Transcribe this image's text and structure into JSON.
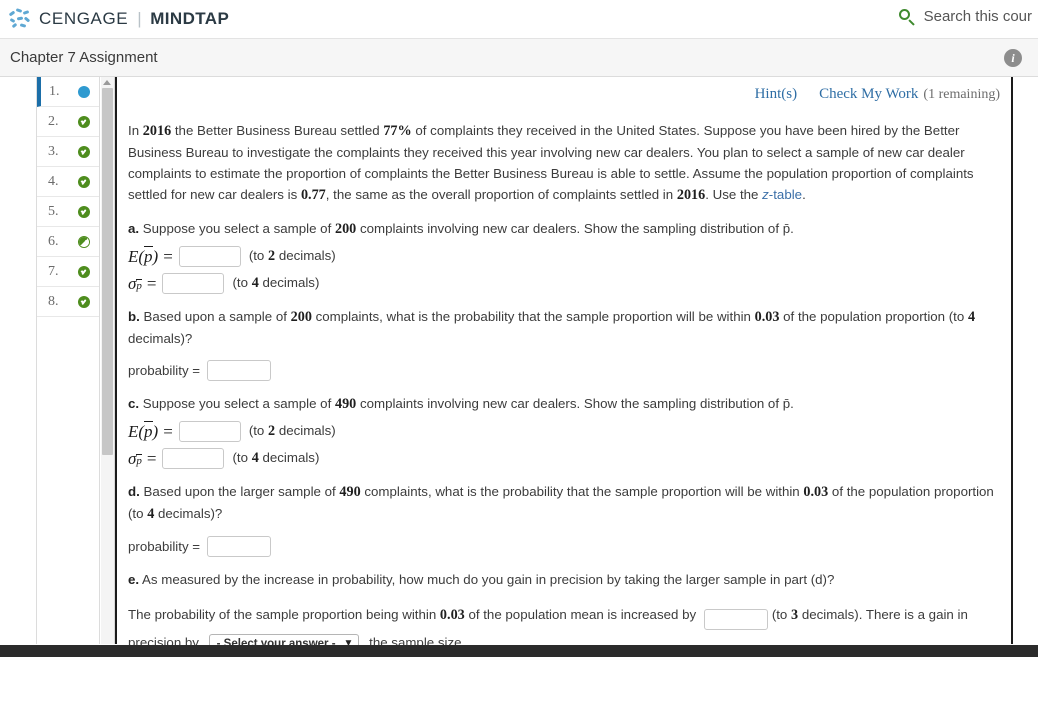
{
  "brand": {
    "name": "CENGAGE",
    "separator": "|",
    "product": "MINDTAP",
    "logo_icon": "cengage-dots-logo"
  },
  "search": {
    "icon": "search-icon",
    "placeholder": "Search this cour"
  },
  "header": {
    "title": "Chapter 7 Assignment",
    "info_icon": "info-icon"
  },
  "question_nav": {
    "items": [
      {
        "label": "1.",
        "status": "current",
        "status_icon": "blue-dot-icon"
      },
      {
        "label": "2.",
        "status": "correct",
        "status_icon": "green-check-icon"
      },
      {
        "label": "3.",
        "status": "correct",
        "status_icon": "green-check-icon"
      },
      {
        "label": "4.",
        "status": "correct",
        "status_icon": "green-check-icon"
      },
      {
        "label": "5.",
        "status": "correct",
        "status_icon": "green-check-icon"
      },
      {
        "label": "6.",
        "status": "partial",
        "status_icon": "half-circle-icon"
      },
      {
        "label": "7.",
        "status": "correct",
        "status_icon": "green-check-icon"
      },
      {
        "label": "8.",
        "status": "correct",
        "status_icon": "green-check-icon"
      }
    ]
  },
  "scrollbar": {
    "up_arrow_icon": "scroll-up-arrow-icon"
  },
  "toolbar": {
    "hints_label": "Hint(s)",
    "check_label": "Check My Work",
    "remaining_label": "(1 remaining)"
  },
  "problem": {
    "intro": {
      "s1": "In ",
      "year1": "2016",
      "s2": " the Better Business Bureau settled ",
      "pct": "77%",
      "s3": " of complaints they received in the United States. Suppose you have been hired by the Better Business Bureau to investigate the complaints they received this year involving new car dealers. You plan to select a sample of new car dealer complaints to estimate the proportion of complaints the Better Business Bureau is able to settle. Assume the population proportion of complaints settled for new car dealers is ",
      "p": "0.77",
      "s4": ", the same as the overall proportion of complaints settled in ",
      "year2": "2016",
      "s5": ". Use the ",
      "link": "z-table",
      "s6": "."
    },
    "parts": [
      {
        "letter": "a.",
        "text_before": " Suppose you select a sample of ",
        "n": "200",
        "text_after": " complaints involving new car dealers. Show the sampling distribution of p̄.",
        "fields": [
          {
            "symbol": "E(p̄)",
            "value": "",
            "hint": "(to ",
            "hint_n": "2",
            "hint_tail": " decimals)"
          },
          {
            "symbol": "σp̄",
            "value": "",
            "hint": "(to ",
            "hint_n": "4",
            "hint_tail": " decimals)"
          }
        ]
      },
      {
        "letter": "b.",
        "text_before": " Based upon a sample of ",
        "n": "200",
        "text_mid": " complaints, what is the probability that the sample proportion will be within ",
        "within": "0.03",
        "text_after": " of the population proportion (to ",
        "dec": "4",
        "text_tail": " decimals)?",
        "answer_label": "probability =",
        "answer_value": ""
      },
      {
        "letter": "c.",
        "text_before": " Suppose you select a sample of ",
        "n": "490",
        "text_after": " complaints involving new car dealers. Show the sampling distribution of p̄.",
        "fields": [
          {
            "symbol": "E(p̄)",
            "value": "",
            "hint": "(to ",
            "hint_n": "2",
            "hint_tail": " decimals)"
          },
          {
            "symbol": "σp̄",
            "value": "",
            "hint": "(to ",
            "hint_n": "4",
            "hint_tail": " decimals)"
          }
        ]
      },
      {
        "letter": "d.",
        "text_before": " Based upon the larger sample of ",
        "n": "490",
        "text_mid": " complaints, what is the probability that the sample proportion will be within ",
        "within": "0.03",
        "text_after": " of the population proportion (to ",
        "dec": "4",
        "text_tail": " decimals)?",
        "answer_label": "probability =",
        "answer_value": ""
      },
      {
        "letter": "e.",
        "text": " As measured by the increase in probability, how much do you gain in precision by taking the larger sample in part (d)?",
        "summary_a": "The probability of the sample proportion being within ",
        "summary_within": "0.03",
        "summary_b": " of the population mean is increased by ",
        "summary_value": "",
        "summary_c": "(to ",
        "summary_dec": "3",
        "summary_d": " decimals). There is a gain in precision by ",
        "select_value": "- Select your answer -",
        "select_chevron_icon": "chevron-down-icon",
        "summary_e": " the sample size."
      }
    ]
  }
}
